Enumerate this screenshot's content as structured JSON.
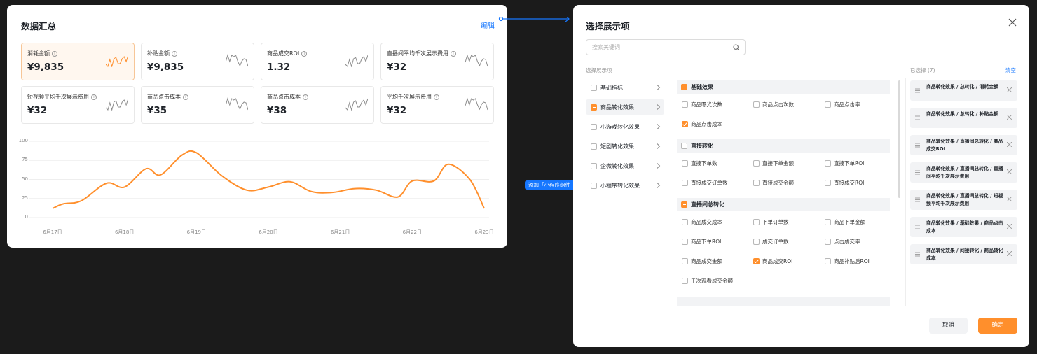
{
  "summary": {
    "title": "数据汇总",
    "edit_label": "编辑",
    "metrics": [
      {
        "label": "消耗金额",
        "value": "¥9,835",
        "active": true
      },
      {
        "label": "补贴金额",
        "value": "¥9,835",
        "active": false
      },
      {
        "label": "商品成交ROI",
        "value": "1.32",
        "active": false
      },
      {
        "label": "直播间平均千次展示费用",
        "value": "¥32",
        "active": false
      },
      {
        "label": "短视频平均千次展示费用",
        "value": "¥32",
        "active": false
      },
      {
        "label": "商品点击成本",
        "value": "¥35",
        "active": false
      },
      {
        "label": "商品点击成本",
        "value": "¥38",
        "active": false
      },
      {
        "label": "平均千次展示费用",
        "value": "¥32",
        "active": false
      }
    ],
    "colors": {
      "accent": "#ff8f2c",
      "spark_gray": "#8c8c8c"
    }
  },
  "chart_data": {
    "type": "line",
    "title": "",
    "xlabel": "",
    "ylabel": "",
    "ylim": [
      0,
      100
    ],
    "yticks": [
      "100",
      "75",
      "50",
      "25",
      "0"
    ],
    "x_ticks": [
      "6月17日",
      "6月18日",
      "6月19日",
      "6月20日",
      "6月21日",
      "6月22日",
      "6月23日"
    ],
    "series": [
      {
        "x": [
          0,
          0.15,
          0.4,
          0.75,
          1.0,
          1.3,
          1.5,
          1.8,
          2.0,
          2.35,
          2.7,
          3.0,
          3.3,
          3.6,
          3.9,
          4.2,
          4.5,
          4.8,
          5.0,
          5.3,
          5.5,
          5.8,
          6.0
        ],
        "values": [
          12,
          18,
          22,
          45,
          40,
          64,
          56,
          82,
          85,
          55,
          36,
          40,
          47,
          34,
          33,
          38,
          36,
          27,
          48,
          48,
          70,
          50,
          12
        ]
      }
    ],
    "grid": true
  },
  "connector": {
    "tag_label": "添加「小程序组件」"
  },
  "dialog": {
    "title": "选择展示项",
    "search_placeholder": "搜索关键词",
    "available_label": "选择展示项",
    "selected_label": "已选择 (7)",
    "clear_label": "清空",
    "categories": [
      {
        "label": "基础指标",
        "state": "none",
        "active": false
      },
      {
        "label": "商品转化效果",
        "state": "partial",
        "active": true
      },
      {
        "label": "小游戏转化效果",
        "state": "none",
        "active": false
      },
      {
        "label": "短剧转化效果",
        "state": "none",
        "active": false
      },
      {
        "label": "企微转化效果",
        "state": "none",
        "active": false
      },
      {
        "label": "小程序转化效果",
        "state": "none",
        "active": false
      }
    ],
    "groups": [
      {
        "label": "基础效果",
        "state": "partial",
        "options": [
          {
            "label": "商品曝光次数",
            "checked": false
          },
          {
            "label": "商品点击次数",
            "checked": false
          },
          {
            "label": "商品点击率",
            "checked": false
          },
          {
            "label": "商品点击成本",
            "checked": true
          }
        ]
      },
      {
        "label": "直接转化",
        "state": "none",
        "options": [
          {
            "label": "直接下单数",
            "checked": false
          },
          {
            "label": "直接下单金额",
            "checked": false
          },
          {
            "label": "直接下单ROI",
            "checked": false
          },
          {
            "label": "直接成交订单数",
            "checked": false
          },
          {
            "label": "直接成交金额",
            "checked": false
          },
          {
            "label": "直接成交ROI",
            "checked": false
          }
        ]
      },
      {
        "label": "直播间总转化",
        "state": "partial",
        "options": [
          {
            "label": "商品成交成本",
            "checked": false
          },
          {
            "label": "下单订单数",
            "checked": false
          },
          {
            "label": "商品下单金额",
            "checked": false
          },
          {
            "label": "商品下单ROI",
            "checked": false
          },
          {
            "label": "成交订单数",
            "checked": false
          },
          {
            "label": "点击成交率",
            "checked": false
          },
          {
            "label": "商品成交金额",
            "checked": false
          },
          {
            "label": "商品成交ROI",
            "checked": true
          },
          {
            "label": "商品补贴后ROI",
            "checked": false
          },
          {
            "label": "千次观看成交金额",
            "checked": false
          }
        ]
      }
    ],
    "selected": [
      "商品转化效果 / 总转化 / 消耗金额",
      "商品转化效果 / 总转化 / 补贴金额",
      "商品转化效果 / 直播间总转化 / 商品成交ROI",
      "商品转化效果 / 直播间总转化 / 直播间平均千次展示费用",
      "商品转化效果 / 直播间总转化 / 短视频平均千次展示费用",
      "商品转化效果 / 基础效果 / 商品点击成本",
      "商品转化效果 / 间接转化 / 商品转化成本"
    ],
    "cancel_label": "取消",
    "ok_label": "确定"
  }
}
